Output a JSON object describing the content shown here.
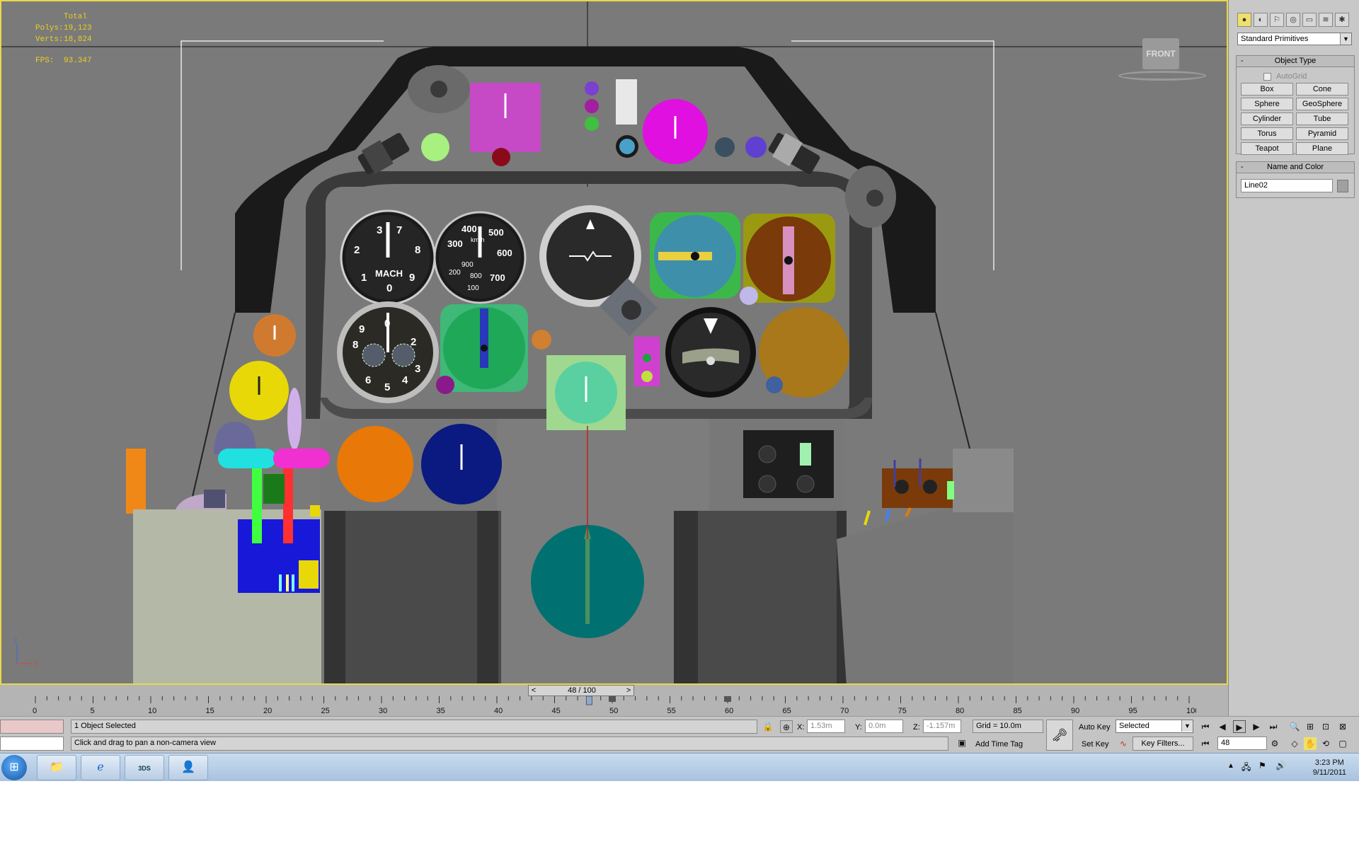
{
  "viewport": {
    "stats": {
      "total_label": "Total",
      "polys_label": "Polys:",
      "polys_value": "19,123",
      "verts_label": "Verts:",
      "verts_value": "18,824",
      "fps_label": "FPS:",
      "fps_value": "93.347"
    },
    "viewcube_label": "FRONT",
    "gauges": {
      "mach": {
        "marks": [
          "3",
          "7",
          "2",
          "8",
          "1",
          "9",
          "0"
        ],
        "label": "MACH"
      },
      "airspeed": {
        "marks": [
          "400",
          "500",
          "300",
          "600",
          "900",
          "200",
          "800",
          "700",
          "100"
        ],
        "unit": "km/h"
      },
      "clock": {
        "marks": [
          "0",
          "9",
          "2",
          "8",
          "3",
          "6",
          "4",
          "5"
        ]
      }
    },
    "gizmo": {
      "x": "x",
      "z": "z"
    }
  },
  "command_panel": {
    "icons": [
      "create-icon",
      "modify-icon",
      "hierarchy-icon",
      "motion-icon",
      "display-icon",
      "utilities-icon"
    ],
    "category": "Standard Primitives",
    "object_type_title": "Object Type",
    "autogrid_label": "AutoGrid",
    "buttons": [
      "Box",
      "Cone",
      "Sphere",
      "GeoSphere",
      "Cylinder",
      "Tube",
      "Torus",
      "Pyramid",
      "Teapot",
      "Plane"
    ],
    "name_color_title": "Name and Color",
    "object_name": "Line02",
    "object_color": "#a0a0a0"
  },
  "timeline": {
    "frame_display": "48 / 100",
    "prev": "<",
    "next": ">",
    "ticks": [
      "0",
      "5",
      "10",
      "15",
      "20",
      "25",
      "30",
      "35",
      "40",
      "45",
      "50",
      "55",
      "60",
      "65",
      "70",
      "75",
      "80",
      "85",
      "90",
      "95",
      "100"
    ]
  },
  "status": {
    "selection": "1 Object Selected",
    "prompt": "Click and drag to pan a non-camera view",
    "x_label": "X:",
    "x_value": "1.53m",
    "y_label": "Y:",
    "y_value": "0.0m",
    "z_label": "Z:",
    "z_value": "-1.157m",
    "grid": "Grid = 10.0m",
    "add_time_tag": "Add Time Tag",
    "auto_key": "Auto Key",
    "set_key": "Set Key",
    "key_mode": "Selected",
    "key_filters": "Key Filters...",
    "current_frame": "48"
  },
  "taskbar": {
    "time": "3:23 PM",
    "date": "9/11/2011",
    "app_3ds_label": "3DS"
  }
}
